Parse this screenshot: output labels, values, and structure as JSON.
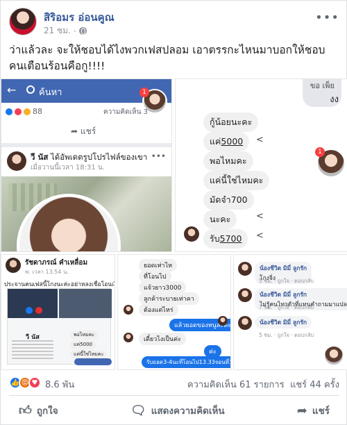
{
  "post": {
    "author": "สิริอมร อ่อนคูณ",
    "time": "21 ชม.",
    "message": "ว่าแล้วละ จะให้ชอบได้ไงพวกเฟสปลอม เอาตรรกะไหนมาบอกให้ชอบ คนเตือนร้อนคือกู!!!!"
  },
  "photo1": {
    "search": "ค้นหา",
    "badge": "1",
    "reaction_count": "88",
    "comment_count": "ความคิดเห็น 3",
    "share": "แชร์",
    "name": "วี นัส",
    "update": "ได้อัพเดตรูปโปรไฟล์ของเขา",
    "time": "เมื่อวานนี้เวลา 18:31 น."
  },
  "photo2": {
    "top1": "ขอ เพ็ย",
    "top2": "งง",
    "badge": "1",
    "messages": [
      {
        "pre": "กู้น้อยนะคะ",
        "u": "",
        "post": ""
      },
      {
        "pre": "แค่",
        "u": "5000",
        "post": ""
      },
      {
        "pre": "พอไหมคะ",
        "u": "",
        "post": ""
      },
      {
        "pre": "แค่นี้ใช่ไหมคะ",
        "u": "",
        "post": ""
      },
      {
        "pre": "มัดจำ700",
        "u": "",
        "post": ""
      },
      {
        "pre": "นะคะ",
        "u": "",
        "post": ""
      },
      {
        "pre": "รับ",
        "u": "5700",
        "post": ""
      }
    ]
  },
  "photo3": {
    "name": "รัชดาภรณ์ คำเหลื่อม",
    "time": "พ. เวลา 13.54 น.",
    "text": "ประจานคนเฟสนี้โกงนะค่ะอย่าหลงเชื่อโอนเงินนะค่ะ",
    "inner_name": "วี นัส",
    "m1": "แค่5000",
    "m2": "แค่นี้ใช่ไหมคะ",
    "m3": "พอไหมคะ"
  },
  "photo4": {
    "m1": "ยอดเท่าไห",
    "m2": "ที่โอนไป",
    "m3": "แจ้วยาว3000",
    "m4": "ลูกค้าระบายเท่าคา",
    "m5": "ต้องแต่ไหร่",
    "b1": "แล้วยอดของหนูละคะ",
    "m6": "เดี๋ยวไงเป็นค่ะ",
    "b2": "ค่ะ",
    "b3": "รับยอด3-4นะที่โอนไป13.33จอนที่13.44เอ้าค่ะ"
  },
  "photo5": {
    "comments": [
      {
        "name": "น้องชีวิต",
        "tag": "มิมี่ ลูกรัก",
        "text": "โกงจิ่ง",
        "time": "5 ชม.",
        "like": "ถูกใจ",
        "reply": "ตอบกลับ"
      },
      {
        "name": "น้องชีวิต",
        "tag": "มิมี่ ลูกรัก",
        "text": "ไม่รู้คนไทวตัวที่แทนคำถามมาแปลกๆ",
        "time": "7 ชม.",
        "like": "ถูกใจ",
        "reply": "ตอบกลับ"
      },
      {
        "name": "น้องชีวิต",
        "tag": "มิมี่ ลูกรัก",
        "text": "",
        "time": "5 ชม.",
        "like": "ถูกใจ",
        "reply": "ตอบกลับ"
      }
    ]
  },
  "stats": {
    "reactions": "8.6 พัน",
    "comments": "ความคิดเห็น 61 รายการ",
    "shares": "แชร์ 44 ครั้ง"
  },
  "actions": {
    "like": "ถูกใจ",
    "comment": "แสดงความคิดเห็น",
    "share": "แชร์"
  }
}
